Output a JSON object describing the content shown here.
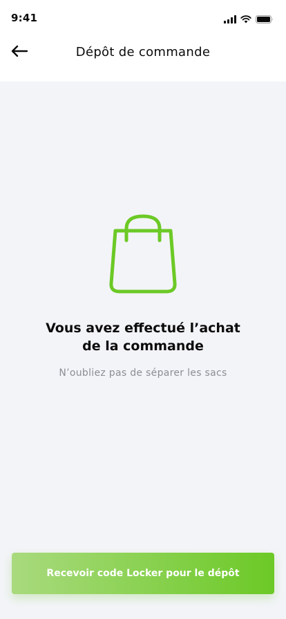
{
  "status_bar": {
    "time": "9:41",
    "icons": [
      "cellular-signal-icon",
      "wifi-icon",
      "battery-icon"
    ]
  },
  "nav": {
    "back_icon": "arrow-left-icon",
    "title": "Dépôt de commande"
  },
  "main": {
    "icon": "shopping-bag-icon",
    "headline_line1": "Vous avez effectué l’achat",
    "headline_line2": "de la commande",
    "subtitle": "N’oubliez pas de séparer les sacs"
  },
  "cta": {
    "label": "Recevoir code Locker pour le dépôt"
  },
  "colors": {
    "accent": "#6CC926",
    "accent_light": "#A9DA7E",
    "background": "#F3F4F8",
    "header_background": "#FFFFFF",
    "text_primary": "#0B0B0B",
    "text_secondary": "#8C8C94"
  }
}
